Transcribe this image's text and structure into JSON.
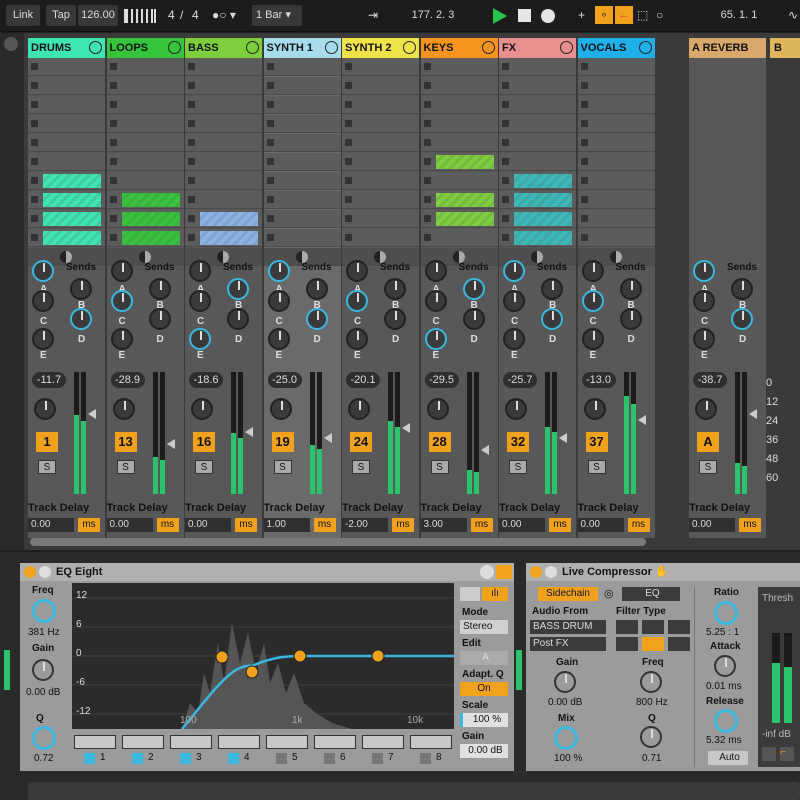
{
  "transport": {
    "link": "Link",
    "tap": "Tap",
    "tempo": "126.00",
    "signature_num": "4",
    "signature_den": "4",
    "quantize": "1 Bar",
    "position": "177.  2.  3",
    "end_position": "65.  1.  1"
  },
  "tracks": [
    {
      "name": "DRUMS",
      "color": "#3ee6b3",
      "volume": "-11.7",
      "number": "1",
      "solo": "S",
      "delay_label": "Track Delay",
      "delay": "0.00",
      "unit": "ms"
    },
    {
      "name": "LOOPS",
      "color": "#36c43c",
      "volume": "-28.9",
      "number": "13",
      "solo": "S",
      "delay_label": "Track Delay",
      "delay": "0.00",
      "unit": "ms"
    },
    {
      "name": "BASS",
      "color": "#7ecf3e",
      "volume": "-18.6",
      "number": "16",
      "solo": "S",
      "delay_label": "Track Delay",
      "delay": "0.00",
      "unit": "ms"
    },
    {
      "name": "SYNTH 1",
      "color": "#a7dcef",
      "volume": "-25.0",
      "number": "19",
      "solo": "S",
      "delay_label": "Track Delay",
      "delay": "1.00",
      "unit": "ms"
    },
    {
      "name": "SYNTH 2",
      "color": "#f0e34a",
      "volume": "-20.1",
      "number": "24",
      "solo": "S",
      "delay_label": "Track Delay",
      "delay": "-2.00",
      "unit": "ms"
    },
    {
      "name": "KEYS",
      "color": "#f7941d",
      "volume": "-29.5",
      "number": "28",
      "solo": "S",
      "delay_label": "Track Delay",
      "delay": "3.00",
      "unit": "ms"
    },
    {
      "name": "FX",
      "color": "#e88f8f",
      "volume": "-25.7",
      "number": "32",
      "solo": "S",
      "delay_label": "Track Delay",
      "delay": "0.00",
      "unit": "ms"
    },
    {
      "name": "VOCALS",
      "color": "#1fb0ea",
      "volume": "-13.0",
      "number": "37",
      "solo": "S",
      "delay_label": "Track Delay",
      "delay": "0.00",
      "unit": "ms"
    }
  ],
  "return": {
    "name": "A REVERB",
    "color": "#d9a96c",
    "volume": "-38.7",
    "letter": "A",
    "solo": "S",
    "delay_label": "Track Delay",
    "delay": "0.00",
    "unit": "ms",
    "next": "B"
  },
  "sends_label": "Sends",
  "send_letters": [
    "A",
    "B",
    "C",
    "D",
    "E"
  ],
  "db_scale": [
    "0",
    "12",
    "24",
    "36",
    "48",
    "60"
  ],
  "eq": {
    "title": "EQ Eight",
    "y_ticks": [
      "12",
      "6",
      "0",
      "-6",
      "-12"
    ],
    "x_ticks": [
      "100",
      "1k",
      "10k"
    ],
    "mode_label": "Mode",
    "mode": "Stereo",
    "edit_label": "Edit",
    "edit": "A",
    "adapt_label": "Adapt. Q",
    "adapt": "On",
    "scale_label": "Scale",
    "scale": "100 %",
    "gain_label": "Gain",
    "gain": "0.00 dB",
    "freq_label": "Freq",
    "freq": "381 Hz",
    "left_gain_label": "Gain",
    "left_gain": "0.00 dB",
    "q_label": "Q",
    "q": "0.72",
    "bands": [
      "1",
      "2",
      "3",
      "4",
      "5",
      "6",
      "7",
      "8"
    ]
  },
  "comp": {
    "title": "Live Compressor",
    "sidechain": "Sidechain",
    "eq": "EQ",
    "audio_from": "Audio From",
    "source": "BASS DRUM",
    "post": "Post FX",
    "filter_type": "Filter Type",
    "gain_label": "Gain",
    "gain": "0.00 dB",
    "mix_label": "Mix",
    "mix": "100 %",
    "freq_label": "Freq",
    "freq": "800 Hz",
    "q_label": "Q",
    "q": "0.71",
    "ratio_label": "Ratio",
    "ratio": "5.25 : 1",
    "attack_label": "Attack",
    "attack": "0.01 ms",
    "release_label": "Release",
    "release": "5.32 ms",
    "auto": "Auto",
    "thresh": "Thresh",
    "inf": "-inf dB"
  }
}
